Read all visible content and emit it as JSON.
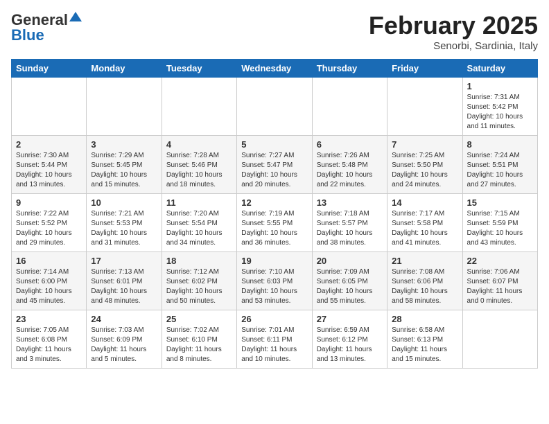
{
  "header": {
    "logo_general": "General",
    "logo_blue": "Blue",
    "month_title": "February 2025",
    "location": "Senorbi, Sardinia, Italy"
  },
  "days_of_week": [
    "Sunday",
    "Monday",
    "Tuesday",
    "Wednesday",
    "Thursday",
    "Friday",
    "Saturday"
  ],
  "weeks": [
    [
      {
        "day": "",
        "info": ""
      },
      {
        "day": "",
        "info": ""
      },
      {
        "day": "",
        "info": ""
      },
      {
        "day": "",
        "info": ""
      },
      {
        "day": "",
        "info": ""
      },
      {
        "day": "",
        "info": ""
      },
      {
        "day": "1",
        "info": "Sunrise: 7:31 AM\nSunset: 5:42 PM\nDaylight: 10 hours and 11 minutes."
      }
    ],
    [
      {
        "day": "2",
        "info": "Sunrise: 7:30 AM\nSunset: 5:44 PM\nDaylight: 10 hours and 13 minutes."
      },
      {
        "day": "3",
        "info": "Sunrise: 7:29 AM\nSunset: 5:45 PM\nDaylight: 10 hours and 15 minutes."
      },
      {
        "day": "4",
        "info": "Sunrise: 7:28 AM\nSunset: 5:46 PM\nDaylight: 10 hours and 18 minutes."
      },
      {
        "day": "5",
        "info": "Sunrise: 7:27 AM\nSunset: 5:47 PM\nDaylight: 10 hours and 20 minutes."
      },
      {
        "day": "6",
        "info": "Sunrise: 7:26 AM\nSunset: 5:48 PM\nDaylight: 10 hours and 22 minutes."
      },
      {
        "day": "7",
        "info": "Sunrise: 7:25 AM\nSunset: 5:50 PM\nDaylight: 10 hours and 24 minutes."
      },
      {
        "day": "8",
        "info": "Sunrise: 7:24 AM\nSunset: 5:51 PM\nDaylight: 10 hours and 27 minutes."
      }
    ],
    [
      {
        "day": "9",
        "info": "Sunrise: 7:22 AM\nSunset: 5:52 PM\nDaylight: 10 hours and 29 minutes."
      },
      {
        "day": "10",
        "info": "Sunrise: 7:21 AM\nSunset: 5:53 PM\nDaylight: 10 hours and 31 minutes."
      },
      {
        "day": "11",
        "info": "Sunrise: 7:20 AM\nSunset: 5:54 PM\nDaylight: 10 hours and 34 minutes."
      },
      {
        "day": "12",
        "info": "Sunrise: 7:19 AM\nSunset: 5:55 PM\nDaylight: 10 hours and 36 minutes."
      },
      {
        "day": "13",
        "info": "Sunrise: 7:18 AM\nSunset: 5:57 PM\nDaylight: 10 hours and 38 minutes."
      },
      {
        "day": "14",
        "info": "Sunrise: 7:17 AM\nSunset: 5:58 PM\nDaylight: 10 hours and 41 minutes."
      },
      {
        "day": "15",
        "info": "Sunrise: 7:15 AM\nSunset: 5:59 PM\nDaylight: 10 hours and 43 minutes."
      }
    ],
    [
      {
        "day": "16",
        "info": "Sunrise: 7:14 AM\nSunset: 6:00 PM\nDaylight: 10 hours and 45 minutes."
      },
      {
        "day": "17",
        "info": "Sunrise: 7:13 AM\nSunset: 6:01 PM\nDaylight: 10 hours and 48 minutes."
      },
      {
        "day": "18",
        "info": "Sunrise: 7:12 AM\nSunset: 6:02 PM\nDaylight: 10 hours and 50 minutes."
      },
      {
        "day": "19",
        "info": "Sunrise: 7:10 AM\nSunset: 6:03 PM\nDaylight: 10 hours and 53 minutes."
      },
      {
        "day": "20",
        "info": "Sunrise: 7:09 AM\nSunset: 6:05 PM\nDaylight: 10 hours and 55 minutes."
      },
      {
        "day": "21",
        "info": "Sunrise: 7:08 AM\nSunset: 6:06 PM\nDaylight: 10 hours and 58 minutes."
      },
      {
        "day": "22",
        "info": "Sunrise: 7:06 AM\nSunset: 6:07 PM\nDaylight: 11 hours and 0 minutes."
      }
    ],
    [
      {
        "day": "23",
        "info": "Sunrise: 7:05 AM\nSunset: 6:08 PM\nDaylight: 11 hours and 3 minutes."
      },
      {
        "day": "24",
        "info": "Sunrise: 7:03 AM\nSunset: 6:09 PM\nDaylight: 11 hours and 5 minutes."
      },
      {
        "day": "25",
        "info": "Sunrise: 7:02 AM\nSunset: 6:10 PM\nDaylight: 11 hours and 8 minutes."
      },
      {
        "day": "26",
        "info": "Sunrise: 7:01 AM\nSunset: 6:11 PM\nDaylight: 11 hours and 10 minutes."
      },
      {
        "day": "27",
        "info": "Sunrise: 6:59 AM\nSunset: 6:12 PM\nDaylight: 11 hours and 13 minutes."
      },
      {
        "day": "28",
        "info": "Sunrise: 6:58 AM\nSunset: 6:13 PM\nDaylight: 11 hours and 15 minutes."
      },
      {
        "day": "",
        "info": ""
      }
    ]
  ]
}
